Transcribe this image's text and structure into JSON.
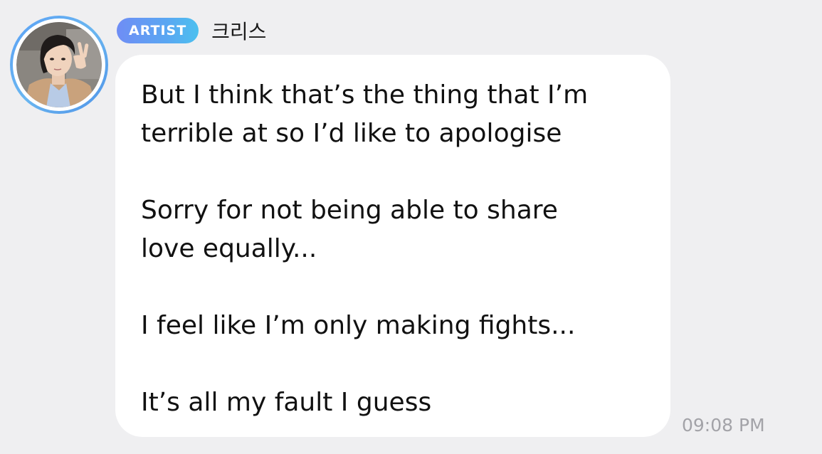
{
  "sender": {
    "badge": "ARTIST",
    "name": "크리스",
    "avatar_icon": "profile-photo",
    "ring_color": "#5aa0f5"
  },
  "message": {
    "paragraphs": [
      [
        "But I think that’s the thing that I’m",
        "terrible at so I’d like to apologise"
      ],
      [
        "Sorry for not being able to share",
        "love equally..."
      ],
      [
        "I feel like I’m only making fights..."
      ],
      [
        "It’s all my fault I guess"
      ]
    ]
  },
  "timestamp": "09:08 PM",
  "colors": {
    "background": "#efeff1",
    "bubble": "#ffffff",
    "badge_start": "#6f8df5",
    "badge_end": "#4cc0ef",
    "timestamp": "#a3a3a8"
  }
}
